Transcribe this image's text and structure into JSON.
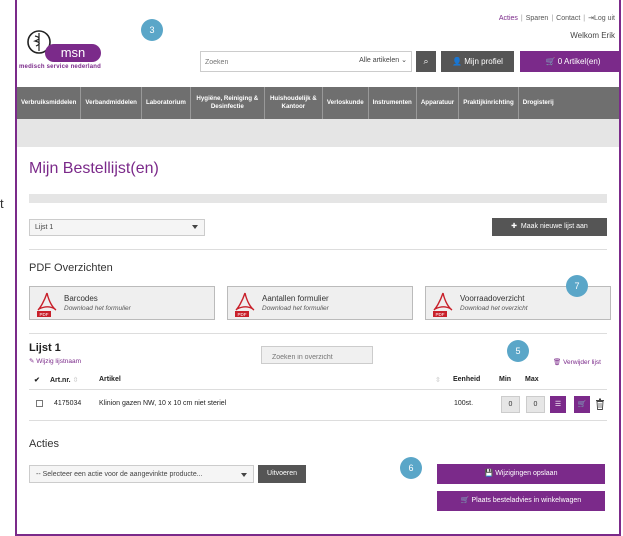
{
  "header": {
    "links": [
      "Acties",
      "Sparen",
      "Contact",
      "Log uit"
    ],
    "welcome": "Welkom Erik",
    "logo_text": "msn",
    "logo_sub": "medisch service nederland",
    "search_placeholder": "Zoeken",
    "search_scope": "Alle artikelen",
    "profile_label": "Mijn profiel",
    "cart_label": "0 Artikel(en)"
  },
  "nav": [
    "Verbruiksmiddelen",
    "Verbandmiddelen",
    "Laboratorium",
    "Hygiëne, Reiniging & Desinfectie",
    "Huishoudelijk & Kantoor",
    "Verloskunde",
    "Instrumenten",
    "Apparatuur",
    "Praktijkinrichting",
    "Drogisterij"
  ],
  "page": {
    "title": "Mijn Bestellijst(en)",
    "list_select": "Lijst 1",
    "new_list_label": "Maak nieuwe lijst aan",
    "pdf_heading": "PDF Overzichten",
    "pdf_cards": [
      {
        "title": "Barcodes",
        "sub": "Download het formulier"
      },
      {
        "title": "Aantallen formulier",
        "sub": "Download het formulier"
      },
      {
        "title": "Voorraadoverzicht",
        "sub": "Download het overzicht"
      }
    ],
    "list_title": "Lijst 1",
    "rename_label": "Wijzig lijstnaam",
    "overview_search": "Zoeken in overzicht",
    "delete_label": "Verwijder lijst"
  },
  "table": {
    "headers": {
      "artnr": "Art.nr.",
      "artikel": "Artikel",
      "eenheid": "Eenheid",
      "min": "Min",
      "max": "Max"
    },
    "rows": [
      {
        "artnr": "4175034",
        "artikel": "Klinion gazen NW, 10 x 10 cm niet steriel",
        "eenheid": "100st.",
        "min": "0",
        "max": "0"
      }
    ]
  },
  "actions": {
    "heading": "Acties",
    "select": "-- Selecteer een actie voor de aangevinkte producte...",
    "run_label": "Uitvoeren",
    "save_label": "Wijzigingen opslaan",
    "order_label": "Plaats besteladvies in winkelwagen"
  },
  "badges": [
    "3",
    "7",
    "5",
    "6"
  ],
  "sidebar_fragment": "t",
  "colors": {
    "accent": "#7b2a8a",
    "badge": "#5aa6c8",
    "nav": "#6f6f6f"
  }
}
